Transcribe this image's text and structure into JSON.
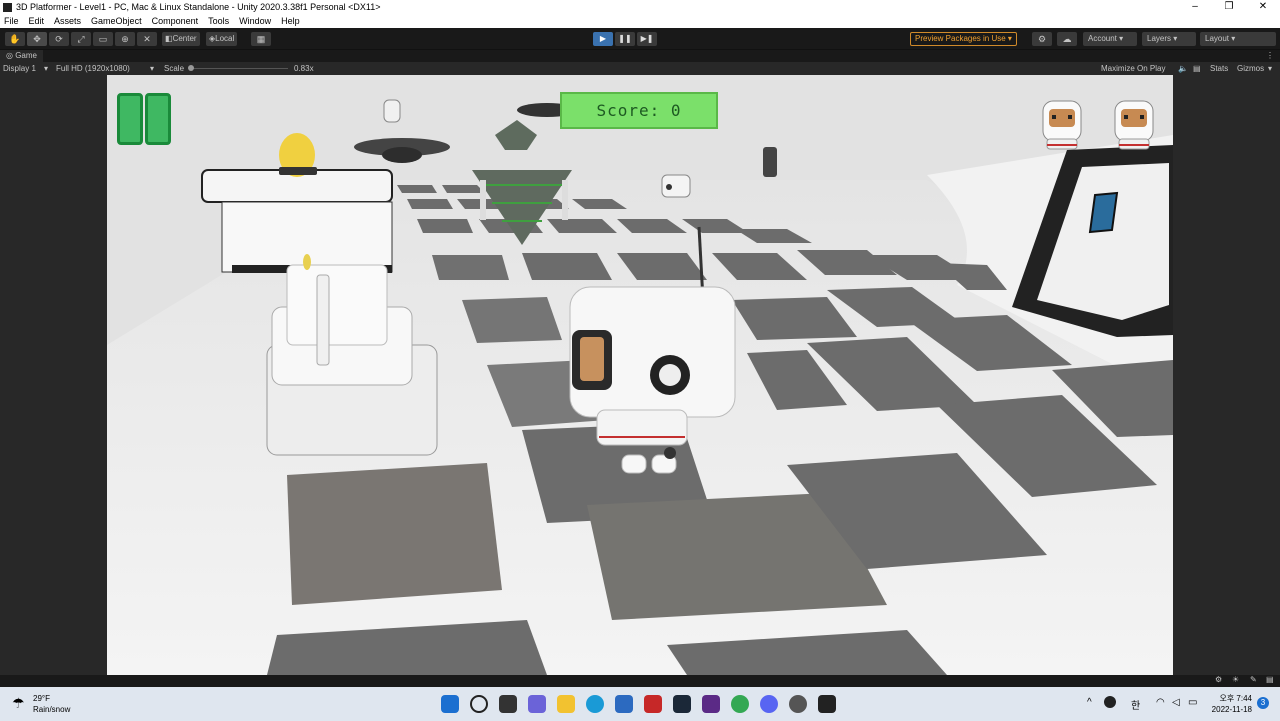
{
  "window": {
    "title": "3D Platformer - Level1 - PC, Mac & Linux Standalone - Unity 2020.3.38f1 Personal <DX11>",
    "controls": [
      "–",
      "❐",
      "✕"
    ]
  },
  "menu": [
    "File",
    "Edit",
    "Assets",
    "GameObject",
    "Component",
    "Tools",
    "Window",
    "Help"
  ],
  "toolbar": {
    "pivot_center": "Center",
    "pivot_local": "Local",
    "preview_packages": "Preview Packages in Use ▾",
    "account": "Account",
    "layers": "Layers",
    "layout": "Layout"
  },
  "game_tab": {
    "label": "Game",
    "display": "Display 1",
    "resolution": "Full HD (1920x1080)",
    "scale_label": "Scale",
    "scale_value": "0.83x",
    "maximize_on_play": "Maximize On Play",
    "stats": "Stats",
    "gizmos": "Gizmos"
  },
  "hud": {
    "score_text": "Score: 0",
    "lives": 2
  },
  "taskbar": {
    "weather_temp": "29°F",
    "weather_desc": "Rain/snow",
    "lang": "한",
    "time_period": "오후 7:44",
    "date": "2022-11-18",
    "notif_count": "3"
  },
  "colors": {
    "score_bg": "#7be06a",
    "pause_green": "#3fb862",
    "play_active": "#3a72b0",
    "preview_orange": "#f0a030"
  }
}
